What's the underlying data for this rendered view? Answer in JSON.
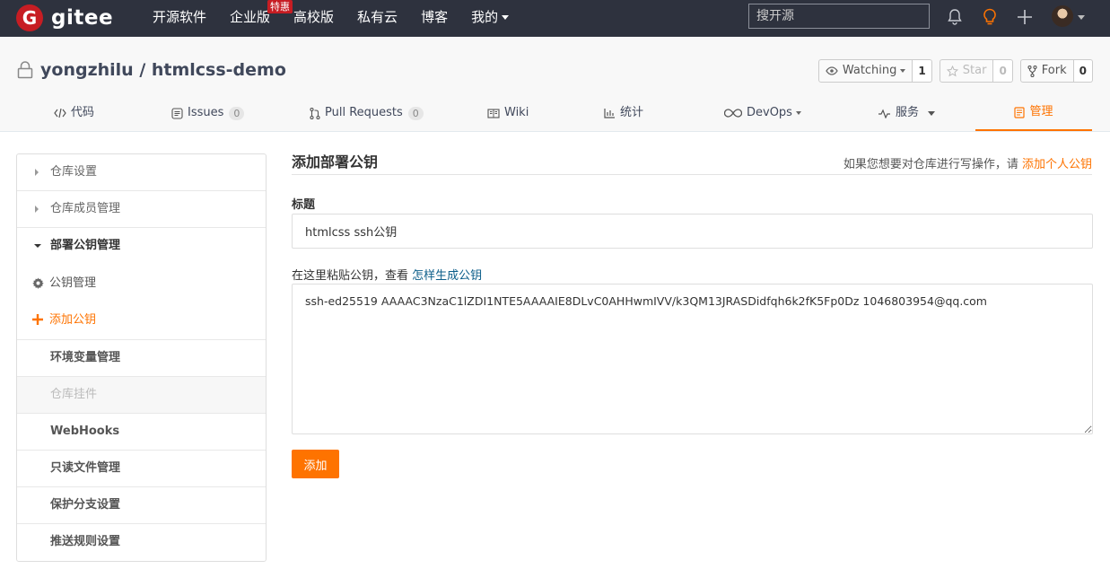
{
  "brand": {
    "name": "gitee",
    "accent": "#fe7300",
    "logo_color": "#c71d23"
  },
  "nav": {
    "items": [
      "开源软件",
      "企业版",
      "高校版",
      "私有云",
      "博客"
    ],
    "mine": "我的",
    "hot_badge": "特惠",
    "search_placeholder": "搜开源"
  },
  "repo": {
    "path": "yongzhilu / htmlcss-demo",
    "watch_label": "Watching",
    "watch_count": "1",
    "star_label": "Star",
    "star_count": "0",
    "fork_label": "Fork",
    "fork_count": "0"
  },
  "tabs": {
    "code": "代码",
    "issues": "Issues",
    "issues_count": "0",
    "pulls": "Pull Requests",
    "pulls_count": "0",
    "wiki": "Wiki",
    "stats": "统计",
    "devops": "DevOps",
    "services": "服务",
    "manage": "管理"
  },
  "sidebar": {
    "repo_settings": "仓库设置",
    "members": "仓库成员管理",
    "deploy_keys": "部署公钥管理",
    "key_manage": "公钥管理",
    "add_key": "添加公钥",
    "env": "环境变量管理",
    "hooks": "仓库挂件",
    "webhooks": "WebHooks",
    "readonly": "只读文件管理",
    "protect": "保护分支设置",
    "push_rules": "推送规则设置"
  },
  "main": {
    "title": "添加部署公钥",
    "hint_prefix": "如果您想要对仓库进行写操作，请",
    "hint_link": "添加个人公钥",
    "title_label": "标题",
    "title_value": "htmlcss ssh公钥",
    "key_label": "在这里粘贴公钥，查看",
    "key_link": "怎样生成公钥",
    "key_value": "ssh-ed25519 AAAAC3NzaC1lZDI1NTE5AAAAIE8DLvC0AHHwmIVV/k3QM13JRASDidfqh6k2fK5Fp0Dz 1046803954@qq.com",
    "submit": "添加"
  }
}
